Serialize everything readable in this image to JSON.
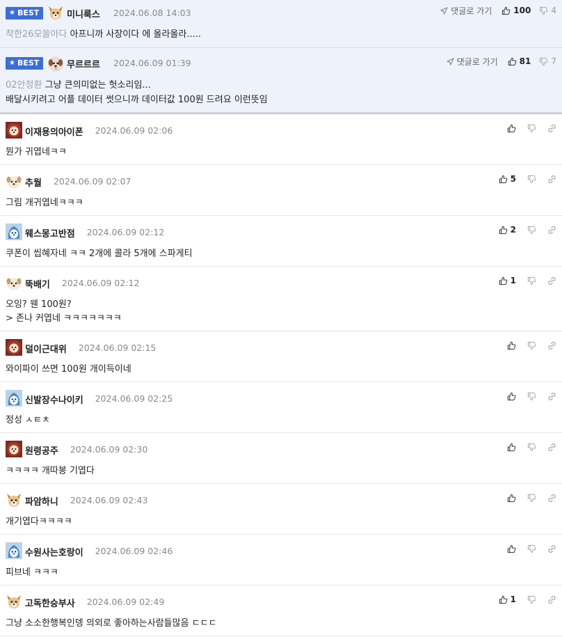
{
  "best_label": "BEST",
  "goto_label": "댓글로 가기",
  "best_comments": [
    {
      "nickname": "미니룩스",
      "timestamp": "2024.06.08 14:03",
      "reply_to": "착한26모쏠아다",
      "lines": [
        "아프니까 사장이다 에 올라올라....."
      ],
      "likes": "100",
      "dislikes": "4",
      "avatar": "chihuahua"
    },
    {
      "nickname": "무르르르",
      "timestamp": "2024.06.09 01:39",
      "reply_to": "02안정환",
      "lines": [
        "그냥 큰의미없는 헛소리임...",
        "배달시키려고 어플 데이터 썻으니까 데이터값 100원 드려요 이런뜻임"
      ],
      "likes": "81",
      "dislikes": "7",
      "avatar": "puppy-face"
    }
  ],
  "comments": [
    {
      "nickname": "이재용의아이폰",
      "timestamp": "2024.06.09 02:06",
      "lines": [
        "뭔가 귀엽네ㅋㅋ"
      ],
      "likes": "",
      "avatar": "lion"
    },
    {
      "nickname": "추월",
      "timestamp": "2024.06.09 02:07",
      "lines": [
        "그림 개귀엽네ㅋㅋㅋ"
      ],
      "likes": "5",
      "avatar": "white-dog"
    },
    {
      "nickname": "웨스몽고반점",
      "timestamp": "2024.06.09 02:12",
      "lines": [
        "쿠폰이 씹혜자네 ㅋㅋ 2개에 콜라 5개에 스파게티"
      ],
      "likes": "2",
      "avatar": "blue-seal"
    },
    {
      "nickname": "뚝배기",
      "timestamp": "2024.06.09 02:12",
      "lines": [
        "오잉? 웬 100원?",
        "> 존나 커엽네 ㅋㅋㅋㅋㅋㅋㅋ"
      ],
      "likes": "1",
      "avatar": "white-dog"
    },
    {
      "nickname": "덜이근대위",
      "timestamp": "2024.06.09 02:15",
      "lines": [
        "와이파이 쓰면 100원 개이득이네"
      ],
      "likes": "",
      "avatar": "lion"
    },
    {
      "nickname": "신발장수나이키",
      "timestamp": "2024.06.09 02:25",
      "lines": [
        "정성 ㅅㅌㅊ"
      ],
      "likes": "",
      "avatar": "blue-seal"
    },
    {
      "nickname": "원령공주",
      "timestamp": "2024.06.09 02:30",
      "lines": [
        "ㅋㅋㅋㅋ 개따봉 기엽다"
      ],
      "likes": "",
      "avatar": "lion"
    },
    {
      "nickname": "파암하니",
      "timestamp": "2024.06.09 02:43",
      "lines": [
        "개기엽다ㅋㅋㅋㅋ"
      ],
      "likes": "",
      "avatar": "chihuahua"
    },
    {
      "nickname": "수원사는호랑이",
      "timestamp": "2024.06.09 02:46",
      "lines": [
        "피브네 ㅋㅋㅋ"
      ],
      "likes": "",
      "avatar": "blue-seal"
    },
    {
      "nickname": "고독한승부사",
      "timestamp": "2024.06.09 02:49",
      "lines": [
        "그냥 소소한행복인뎅 의외로 좋아하는사람들많음 ㄷㄷㄷ"
      ],
      "likes": "1",
      "avatar": "chihuahua"
    }
  ]
}
